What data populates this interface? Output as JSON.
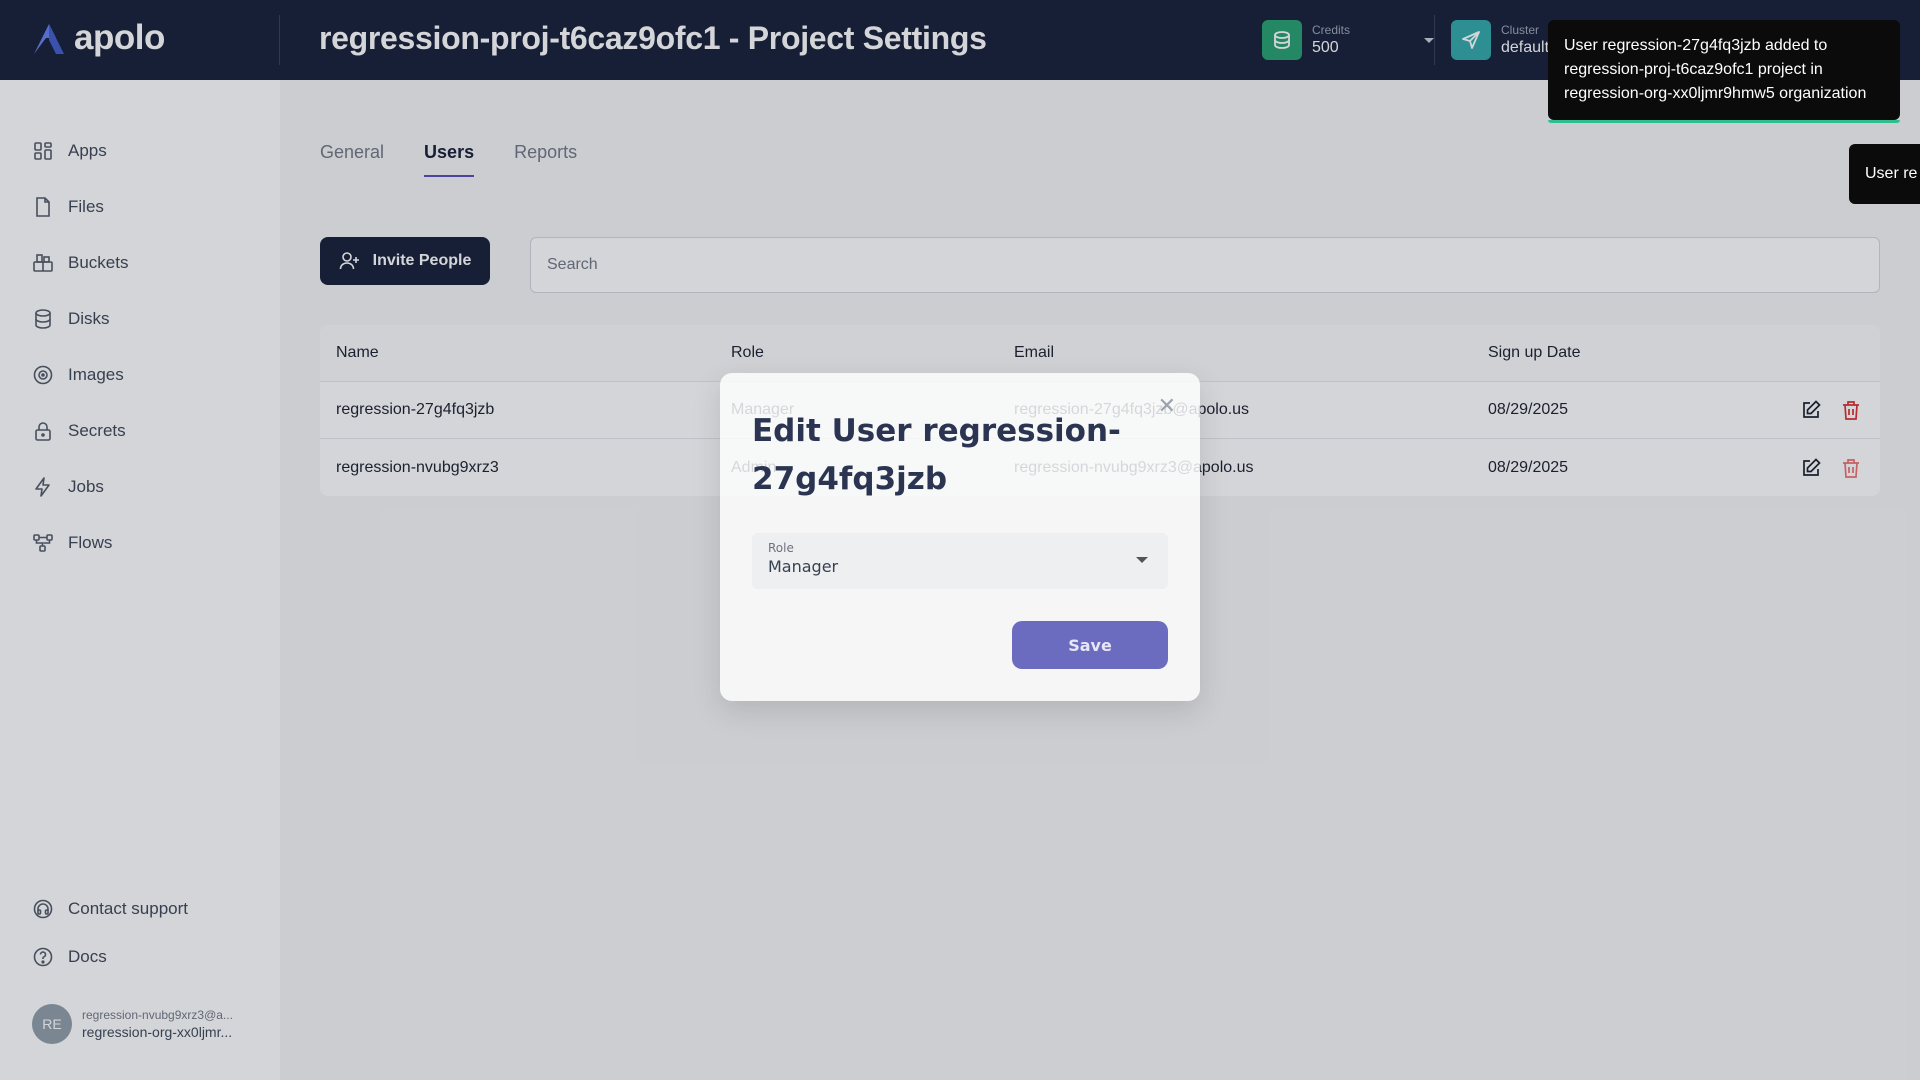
{
  "header": {
    "brand": "apolo",
    "title": "regression-proj-t6caz9ofc1 - Project Settings",
    "credits": {
      "label": "Credits",
      "value": "500"
    },
    "cluster": {
      "label": "Cluster",
      "value": "default"
    }
  },
  "sidebar": {
    "items": [
      {
        "label": "Apps",
        "icon": "apps-icon"
      },
      {
        "label": "Files",
        "icon": "file-icon"
      },
      {
        "label": "Buckets",
        "icon": "bucket-icon"
      },
      {
        "label": "Disks",
        "icon": "database-icon"
      },
      {
        "label": "Images",
        "icon": "image-icon"
      },
      {
        "label": "Secrets",
        "icon": "lock-icon"
      },
      {
        "label": "Jobs",
        "icon": "lightning-icon"
      },
      {
        "label": "Flows",
        "icon": "flow-icon"
      }
    ],
    "footer": [
      {
        "label": "Contact support",
        "icon": "headset-icon"
      },
      {
        "label": "Docs",
        "icon": "question-icon"
      }
    ],
    "user": {
      "initials": "RE",
      "email": "regression-nvubg9xrz3@a...",
      "org": "regression-org-xx0ljmr..."
    }
  },
  "tabs": [
    {
      "label": "General",
      "active": false
    },
    {
      "label": "Users",
      "active": true
    },
    {
      "label": "Reports",
      "active": false
    }
  ],
  "toolbar": {
    "invite_label": "Invite People",
    "search_placeholder": "Search"
  },
  "table": {
    "columns": [
      "Name",
      "Role",
      "Email",
      "Sign up Date"
    ],
    "rows": [
      {
        "name": "regression-27g4fq3jzb",
        "role": "Manager",
        "email": "regression-27g4fq3jzb@apolo.us",
        "date": "08/29/2025"
      },
      {
        "name": "regression-nvubg9xrz3",
        "role": "Admin",
        "email": "regression-nvubg9xrz3@apolo.us",
        "date": "08/29/2025"
      }
    ]
  },
  "modal": {
    "title": "Edit User regression-27g4fq3jzb",
    "role_label": "Role",
    "role_value": "Manager",
    "save_label": "Save",
    "close_glyph": "✕"
  },
  "toasts": [
    {
      "text": "User regression-27g4fq3jzb added to regression-proj-t6caz9ofc1 project in regression-org-xx0ljmr9hmw5 organization"
    },
    {
      "text": "User re"
    }
  ],
  "colors": {
    "header_bg": "#0e1630",
    "accent": "#4f46b8",
    "credits_icon_bg": "#1f9d6b",
    "cluster_icon_bg": "#2aa6a6",
    "toast_bar": "#2fbf8f",
    "danger": "#dc2626"
  }
}
